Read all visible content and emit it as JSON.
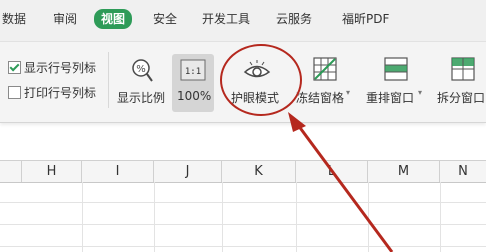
{
  "tabs": [
    {
      "label": "数据",
      "active": false
    },
    {
      "label": "审阅",
      "active": false
    },
    {
      "label": "视图",
      "active": true
    },
    {
      "label": "安全",
      "active": false
    },
    {
      "label": "开发工具",
      "active": false
    },
    {
      "label": "云服务",
      "active": false
    },
    {
      "label": "福昕PDF",
      "active": false
    }
  ],
  "ribbon": {
    "show_row_col_headers": {
      "label": "显示行号列标",
      "checked": true
    },
    "print_row_col_headers": {
      "label": "打印行号列标",
      "checked": false
    },
    "zoom_label": "显示比例",
    "zoom_100_label": "100%",
    "zoom_100_icon_text": "1:1",
    "eye_protection_label": "护眼模式",
    "freeze_panes_label": "冻结窗格",
    "arrange_windows_label": "重排窗口",
    "split_window_label": "拆分窗口"
  },
  "columns": [
    "H",
    "I",
    "J",
    "K",
    "L",
    "M",
    "N"
  ],
  "colors": {
    "accent": "#2e9b58",
    "annotation": "#b5281e"
  }
}
